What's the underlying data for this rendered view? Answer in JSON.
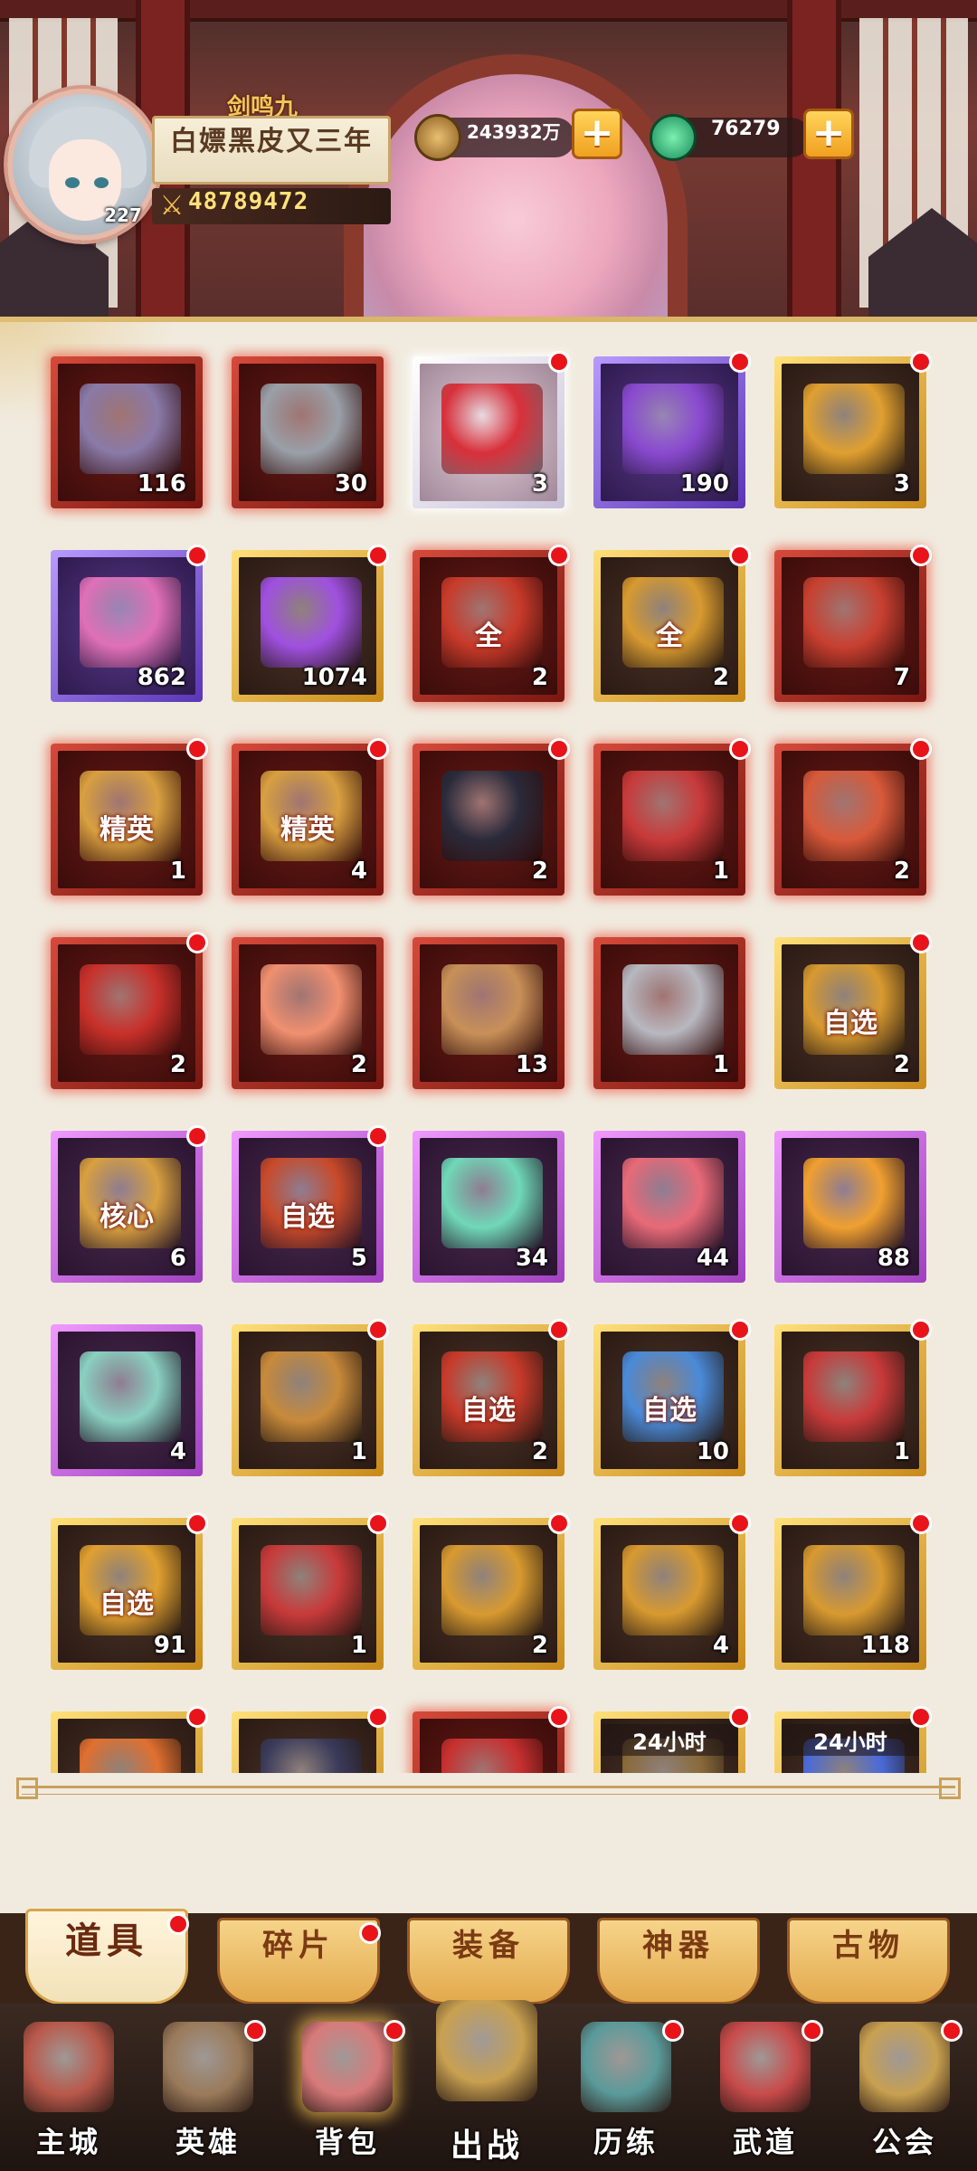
{
  "player": {
    "game_logo": "剑鸣九霄",
    "name": "白嫖黑皮又三年",
    "level": "227",
    "power": "48789472",
    "power_icon": "crossed-swords-icon",
    "avatar": "player-avatar"
  },
  "resources": [
    {
      "name": "coins",
      "icon": "coin-icon",
      "value": "243932万",
      "add": "+"
    },
    {
      "name": "jade",
      "icon": "jade-icon",
      "value": "76279",
      "add": "+"
    }
  ],
  "items": [
    {
      "rarity": "red",
      "count": "116",
      "label": "",
      "header": "",
      "badge": false,
      "icon": "shark-secret-coupon-icon",
      "art": "#8a7aa8"
    },
    {
      "rarity": "red",
      "count": "30",
      "label": "",
      "header": "",
      "badge": false,
      "icon": "teapot-card-icon",
      "art": "#9aa0a8"
    },
    {
      "rarity": "white",
      "count": "3",
      "label": "",
      "header": "",
      "badge": true,
      "icon": "red-gift-box-icon",
      "art": "#d8303a"
    },
    {
      "rarity": "purple",
      "count": "190",
      "label": "",
      "header": "",
      "badge": true,
      "icon": "purple-puzzle-chest-icon",
      "art": "#8a4ad0"
    },
    {
      "rarity": "gold",
      "count": "3",
      "label": "",
      "header": "",
      "badge": true,
      "icon": "golden-treasure-chest-icon",
      "art": "#e0a030"
    },
    {
      "rarity": "purple",
      "count": "862",
      "label": "",
      "header": "",
      "badge": true,
      "icon": "pink-pouch-icon",
      "art": "#e070b8"
    },
    {
      "rarity": "gold",
      "count": "1074",
      "label": "",
      "header": "",
      "badge": true,
      "icon": "purple-puzzle-chest-icon",
      "art": "#a050e0"
    },
    {
      "rarity": "red",
      "count": "2",
      "label": "全",
      "header": "",
      "badge": true,
      "icon": "red-chest-all-icon",
      "art": "#c83a2a"
    },
    {
      "rarity": "gold",
      "count": "2",
      "label": "全",
      "header": "",
      "badge": true,
      "icon": "gold-chest-all-icon",
      "art": "#d89a30"
    },
    {
      "rarity": "red",
      "count": "7",
      "label": "",
      "header": "",
      "badge": true,
      "icon": "mascot-chest-icon",
      "art": "#c84030"
    },
    {
      "rarity": "red",
      "count": "1",
      "label": "精英",
      "header": "",
      "badge": true,
      "icon": "elite-chest-icon",
      "art": "#d8a040"
    },
    {
      "rarity": "red",
      "count": "4",
      "label": "精英",
      "header": "",
      "badge": true,
      "icon": "elite-demon-chest-icon",
      "art": "#d8a040"
    },
    {
      "rarity": "red",
      "count": "2",
      "label": "",
      "header": "",
      "badge": true,
      "icon": "black-gold-chest-icon",
      "art": "#2a2a3a"
    },
    {
      "rarity": "red",
      "count": "1",
      "label": "",
      "header": "",
      "badge": true,
      "icon": "red-chest-star-icon",
      "art": "#c83a3a"
    },
    {
      "rarity": "red",
      "count": "2",
      "label": "",
      "header": "",
      "badge": true,
      "icon": "red-chest-hero-icon",
      "art": "#d85a3a"
    },
    {
      "rarity": "red",
      "count": "2",
      "label": "",
      "header": "",
      "badge": true,
      "icon": "festive-gift-box-icon",
      "art": "#c8302a"
    },
    {
      "rarity": "red",
      "count": "2",
      "label": "",
      "header": "",
      "badge": false,
      "icon": "orange-egg-icon",
      "art": "#f09070"
    },
    {
      "rarity": "red",
      "count": "13",
      "label": "",
      "header": "",
      "badge": false,
      "icon": "scroll-orb-icon",
      "art": "#c89058"
    },
    {
      "rarity": "red",
      "count": "1",
      "label": "",
      "header": "",
      "badge": false,
      "icon": "silver-key-icon",
      "art": "#b8b8c0"
    },
    {
      "rarity": "gold",
      "count": "2",
      "label": "自选",
      "header": "",
      "badge": true,
      "icon": "select-chest-icon",
      "art": "#d89a30"
    },
    {
      "rarity": "pink",
      "count": "6",
      "label": "核心",
      "header": "",
      "badge": true,
      "icon": "core-demon-chest-icon",
      "art": "#d8a040"
    },
    {
      "rarity": "pink",
      "count": "5",
      "label": "自选",
      "header": "",
      "badge": true,
      "icon": "select-hero-chest-icon",
      "art": "#c84a2a"
    },
    {
      "rarity": "pink",
      "count": "34",
      "label": "",
      "header": "",
      "badge": false,
      "icon": "jade-bowl-icon",
      "art": "#70d8b8"
    },
    {
      "rarity": "pink",
      "count": "44",
      "label": "",
      "header": "",
      "badge": false,
      "icon": "feather-icon",
      "art": "#e86a78"
    },
    {
      "rarity": "pink",
      "count": "88",
      "label": "",
      "header": "",
      "badge": false,
      "icon": "orange-orb-icon",
      "art": "#f0a030"
    },
    {
      "rarity": "pink",
      "count": "4",
      "label": "",
      "header": "",
      "badge": false,
      "icon": "jade-pendant-icon",
      "art": "#8ad0c0"
    },
    {
      "rarity": "gold",
      "count": "1",
      "label": "",
      "header": "",
      "badge": true,
      "icon": "wooden-chest-icon",
      "art": "#c88a3a"
    },
    {
      "rarity": "gold",
      "count": "2",
      "label": "自选",
      "header": "",
      "badge": true,
      "icon": "select-shadow-chest-icon",
      "art": "#c83a2a"
    },
    {
      "rarity": "gold",
      "count": "10",
      "label": "自选",
      "header": "",
      "badge": true,
      "icon": "select-gem-chest-icon",
      "art": "#4a8ad8"
    },
    {
      "rarity": "gold",
      "count": "1",
      "label": "",
      "header": "",
      "badge": true,
      "icon": "monster-chest-icon",
      "art": "#c83a3a"
    },
    {
      "rarity": "gold",
      "count": "91",
      "label": "自选",
      "header": "",
      "badge": true,
      "icon": "select-flower-chest-icon",
      "art": "#e0a030"
    },
    {
      "rarity": "gold",
      "count": "1",
      "label": "",
      "header": "",
      "badge": true,
      "icon": "red-chest-star-icon",
      "art": "#c83a3a"
    },
    {
      "rarity": "gold",
      "count": "2",
      "label": "",
      "header": "",
      "badge": true,
      "icon": "coin-chest-icon",
      "art": "#d89a30"
    },
    {
      "rarity": "gold",
      "count": "4",
      "label": "",
      "header": "",
      "badge": true,
      "icon": "gold-chest-hero-icon",
      "art": "#d89a30"
    },
    {
      "rarity": "gold",
      "count": "118",
      "label": "",
      "header": "",
      "badge": true,
      "icon": "food-chest-icon",
      "art": "#d89a30"
    },
    {
      "rarity": "gold",
      "count": "",
      "label": "",
      "header": "",
      "badge": true,
      "icon": "orange-chest-icon",
      "art": "#e07030"
    },
    {
      "rarity": "gold",
      "count": "",
      "label": "",
      "header": "",
      "badge": true,
      "icon": "dark-chest-icon",
      "art": "#3a3a5a"
    },
    {
      "rarity": "red",
      "count": "",
      "label": "",
      "header": "",
      "badge": true,
      "icon": "red-envelope-icon",
      "art": "#c83030"
    },
    {
      "rarity": "gold",
      "count": "",
      "label": "",
      "header": "24小时",
      "badge": true,
      "icon": "timed-chest-icon",
      "art": "#8a6a3a"
    },
    {
      "rarity": "gold",
      "count": "",
      "label": "",
      "header": "24小时",
      "badge": true,
      "icon": "timed-blue-chest-icon",
      "art": "#4a6ad8"
    }
  ],
  "tabs": [
    {
      "label": "道具",
      "active": true,
      "badge": true
    },
    {
      "label": "碎片",
      "active": false,
      "badge": true
    },
    {
      "label": "装备",
      "active": false,
      "badge": false
    },
    {
      "label": "神器",
      "active": false,
      "badge": false
    },
    {
      "label": "古物",
      "active": false,
      "badge": false
    }
  ],
  "nav": [
    {
      "label": "主城",
      "icon": "city-gate-icon",
      "badge": false,
      "color": "#b8584a"
    },
    {
      "label": "英雄",
      "icon": "hero-hat-icon",
      "badge": true,
      "color": "#9a7a5a"
    },
    {
      "label": "背包",
      "icon": "backpack-icon",
      "badge": true,
      "color": "#d87a7a",
      "active": true
    },
    {
      "label": "出战",
      "icon": "crossed-swords-icon",
      "badge": false,
      "color": "#c8a050",
      "center": true
    },
    {
      "label": "历练",
      "icon": "mountain-statue-icon",
      "badge": true,
      "color": "#5a9a9a"
    },
    {
      "label": "武道",
      "icon": "drum-icon",
      "badge": true,
      "color": "#c84a4a"
    },
    {
      "label": "公会",
      "icon": "guild-shield-icon",
      "badge": true,
      "color": "#c8a050"
    }
  ]
}
